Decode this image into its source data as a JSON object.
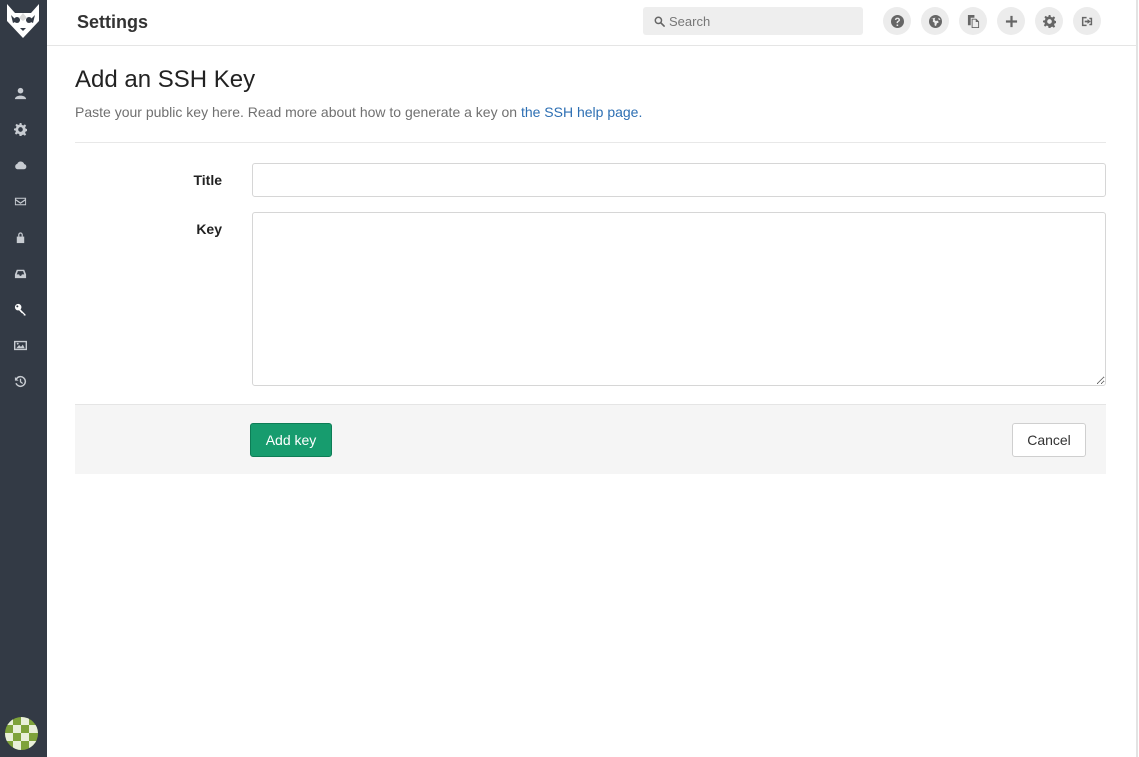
{
  "header": {
    "title": "Settings",
    "search_placeholder": "Search",
    "actions": [
      "help-icon",
      "globe-icon",
      "copy-icon",
      "plus-icon",
      "gear-icon",
      "sign-out-icon"
    ]
  },
  "sidebar": {
    "items": [
      {
        "icon": "user-icon"
      },
      {
        "icon": "gear-icon"
      },
      {
        "icon": "cloud-icon"
      },
      {
        "icon": "envelope-icon"
      },
      {
        "icon": "lock-icon"
      },
      {
        "icon": "inbox-icon"
      },
      {
        "icon": "key-icon",
        "active": true
      },
      {
        "icon": "image-icon"
      },
      {
        "icon": "history-icon"
      }
    ]
  },
  "main": {
    "heading": "Add an SSH Key",
    "description": "Paste your public key here. Read more about how to generate a key on ",
    "help_link": "the SSH help page.",
    "title_label": "Title",
    "title_value": "",
    "key_label": "Key",
    "key_value": "",
    "add_button": "Add key",
    "cancel_button": "Cancel"
  },
  "colors": {
    "sidebar": "#333a45",
    "primary": "#179c6e",
    "link": "#2d6fb3"
  }
}
